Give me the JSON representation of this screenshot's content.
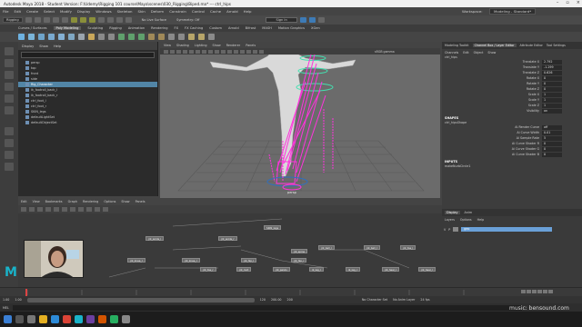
{
  "title_bar": {
    "text": "Autodesk Maya 2018 - Student Version: F:\\Udemy\\Rigging 101 course\\Maya\\scenes\\030_Rigging\\Biped.ma* --- ctrl_hips"
  },
  "menubar": {
    "items": [
      "File",
      "Edit",
      "Create",
      "Select",
      "Modify",
      "Display",
      "Windows",
      "Skeleton",
      "Skin",
      "Deform",
      "Constrain",
      "Control",
      "Cache",
      "Arnold",
      "Help"
    ],
    "toolbar_selector": "Rigging",
    "symmetry": "Symmetry: Off",
    "no_live_surface": "No Live Surface",
    "sign_in": "Sign In",
    "workspace_label": "Workspace:",
    "workspace_value": "Modeling - Standard*"
  },
  "shelf_tabs": [
    "Curves / Surfaces",
    "Poly Modeling",
    "Sculpting",
    "Rigging",
    "Animation",
    "Rendering",
    "FX",
    "FX Caching",
    "Custom",
    "Arnold",
    "Bifrost",
    "MASH",
    "Motion Graphics",
    "XGen"
  ],
  "shelf_active_tab": "Poly Modeling",
  "outliner": {
    "menu": [
      "Display",
      "Show",
      "Help"
    ],
    "items": [
      {
        "label": "persp",
        "selected": false
      },
      {
        "label": "top",
        "selected": false
      },
      {
        "label": "front",
        "selected": false
      },
      {
        "label": "side",
        "selected": false
      },
      {
        "label": "Rig_Character",
        "selected": true
      },
      {
        "label": "ik_footroll_back_l",
        "selected": false
      },
      {
        "label": "ik_footroll_back_r",
        "selected": false
      },
      {
        "label": "ctrl_foot_l",
        "selected": false
      },
      {
        "label": "ctrl_foot_r",
        "selected": false
      },
      {
        "label": "SKIN_legs",
        "selected": false
      },
      {
        "label": "defaultLightSet",
        "selected": false
      },
      {
        "label": "defaultObjectSet",
        "selected": false
      }
    ]
  },
  "viewport": {
    "menu": [
      "View",
      "Shading",
      "Lighting",
      "Show",
      "Renderer",
      "Panels"
    ],
    "camera_label": "persp",
    "colorspace": "sRGB gamma"
  },
  "channel_box": {
    "tabs": [
      "Modeling Toolkit",
      "Channel Box / Layer Editor",
      "Attribute Editor",
      "Tool Settings"
    ],
    "active_tab": "Channel Box / Layer Editor",
    "menu": [
      "Channels",
      "Edit",
      "Object",
      "Show"
    ],
    "object": "ctrl_hips",
    "attributes": [
      {
        "name": "Translate X",
        "value": "2.792"
      },
      {
        "name": "Translate Y",
        "value": "-1.299"
      },
      {
        "name": "Translate Z",
        "value": "0.626"
      },
      {
        "name": "Rotate X",
        "value": "0"
      },
      {
        "name": "Rotate Y",
        "value": "0"
      },
      {
        "name": "Rotate Z",
        "value": "0"
      },
      {
        "name": "Scale X",
        "value": "1"
      },
      {
        "name": "Scale Y",
        "value": "1"
      },
      {
        "name": "Scale Z",
        "value": "1"
      },
      {
        "name": "Visibility",
        "value": "on"
      }
    ],
    "shapes_header": "SHAPES",
    "shape_name": "ctrl_hipsShape",
    "shape_attributes": [
      {
        "name": "Ai Render Curve",
        "value": "off"
      },
      {
        "name": "Ai Curve Width",
        "value": "0.01"
      },
      {
        "name": "Ai Sample Rate",
        "value": "5"
      },
      {
        "name": "Ai Curve Shader R",
        "value": "0"
      },
      {
        "name": "Ai Curve Shader G",
        "value": "0"
      },
      {
        "name": "Ai Curve Shader B",
        "value": "0"
      }
    ],
    "inputs_header": "INPUTS",
    "input_name": "makeNurbCircle1"
  },
  "node_editor": {
    "menu": [
      "Edit",
      "View",
      "Bookmarks",
      "Graph",
      "Rendering",
      "Options",
      "Show",
      "Panels"
    ],
    "nodes": [
      {
        "label": "SKIN_legs",
        "col": "a"
      },
      {
        "label": "jnt_ankle_l",
        "col": "b"
      },
      {
        "label": "jnt_ankle_r",
        "col": "c"
      },
      {
        "label": "jnt_knee_l",
        "col": "d"
      },
      {
        "label": "jnt_knee_r",
        "col": "e"
      },
      {
        "label": "jnt_hip_l",
        "col": "f"
      },
      {
        "label": "jnt_hip_r",
        "col": "g"
      },
      {
        "label": "jnt_ball_l",
        "col": "h"
      },
      {
        "label": "jnt_ball_r",
        "col": "i"
      },
      {
        "label": "jnt_toe_l",
        "col": "j"
      },
      {
        "label": "jnt_toe_r",
        "col": "k"
      },
      {
        "label": "jnt_root",
        "col": "l"
      },
      {
        "label": "jnt_pelvis",
        "col": "m"
      },
      {
        "label": "ik_leg_l",
        "col": "n"
      },
      {
        "label": "ik_leg_r",
        "col": "o"
      },
      {
        "label": "jnt_heel_l",
        "col": "p"
      },
      {
        "label": "jnt_heel_r",
        "col": "q"
      },
      {
        "label": "jnt_spine",
        "col": "r"
      }
    ]
  },
  "layers": {
    "tabs": [
      "Display",
      "Anim"
    ],
    "active_tab": "Display",
    "menu": [
      "Layers",
      "Options",
      "Help"
    ],
    "layer_v": "V",
    "layer_p": "P",
    "layer_name": "geo"
  },
  "range": {
    "start": "1.00",
    "start_inner": "1.00",
    "end_inner": "120",
    "end": "200.00",
    "end_outer": "200",
    "character_set": "No Character Set",
    "anim_layer": "No Anim Layer",
    "fps": "24 fps"
  },
  "command_line": {
    "label": "MEL"
  },
  "watermark": "music: bensound.com",
  "colors": {
    "accent_pink": "#ff33dd",
    "selection_blue": "#5285a6",
    "layer_blue": "#6aa0d8",
    "maya_logo": "#19b3c9"
  }
}
